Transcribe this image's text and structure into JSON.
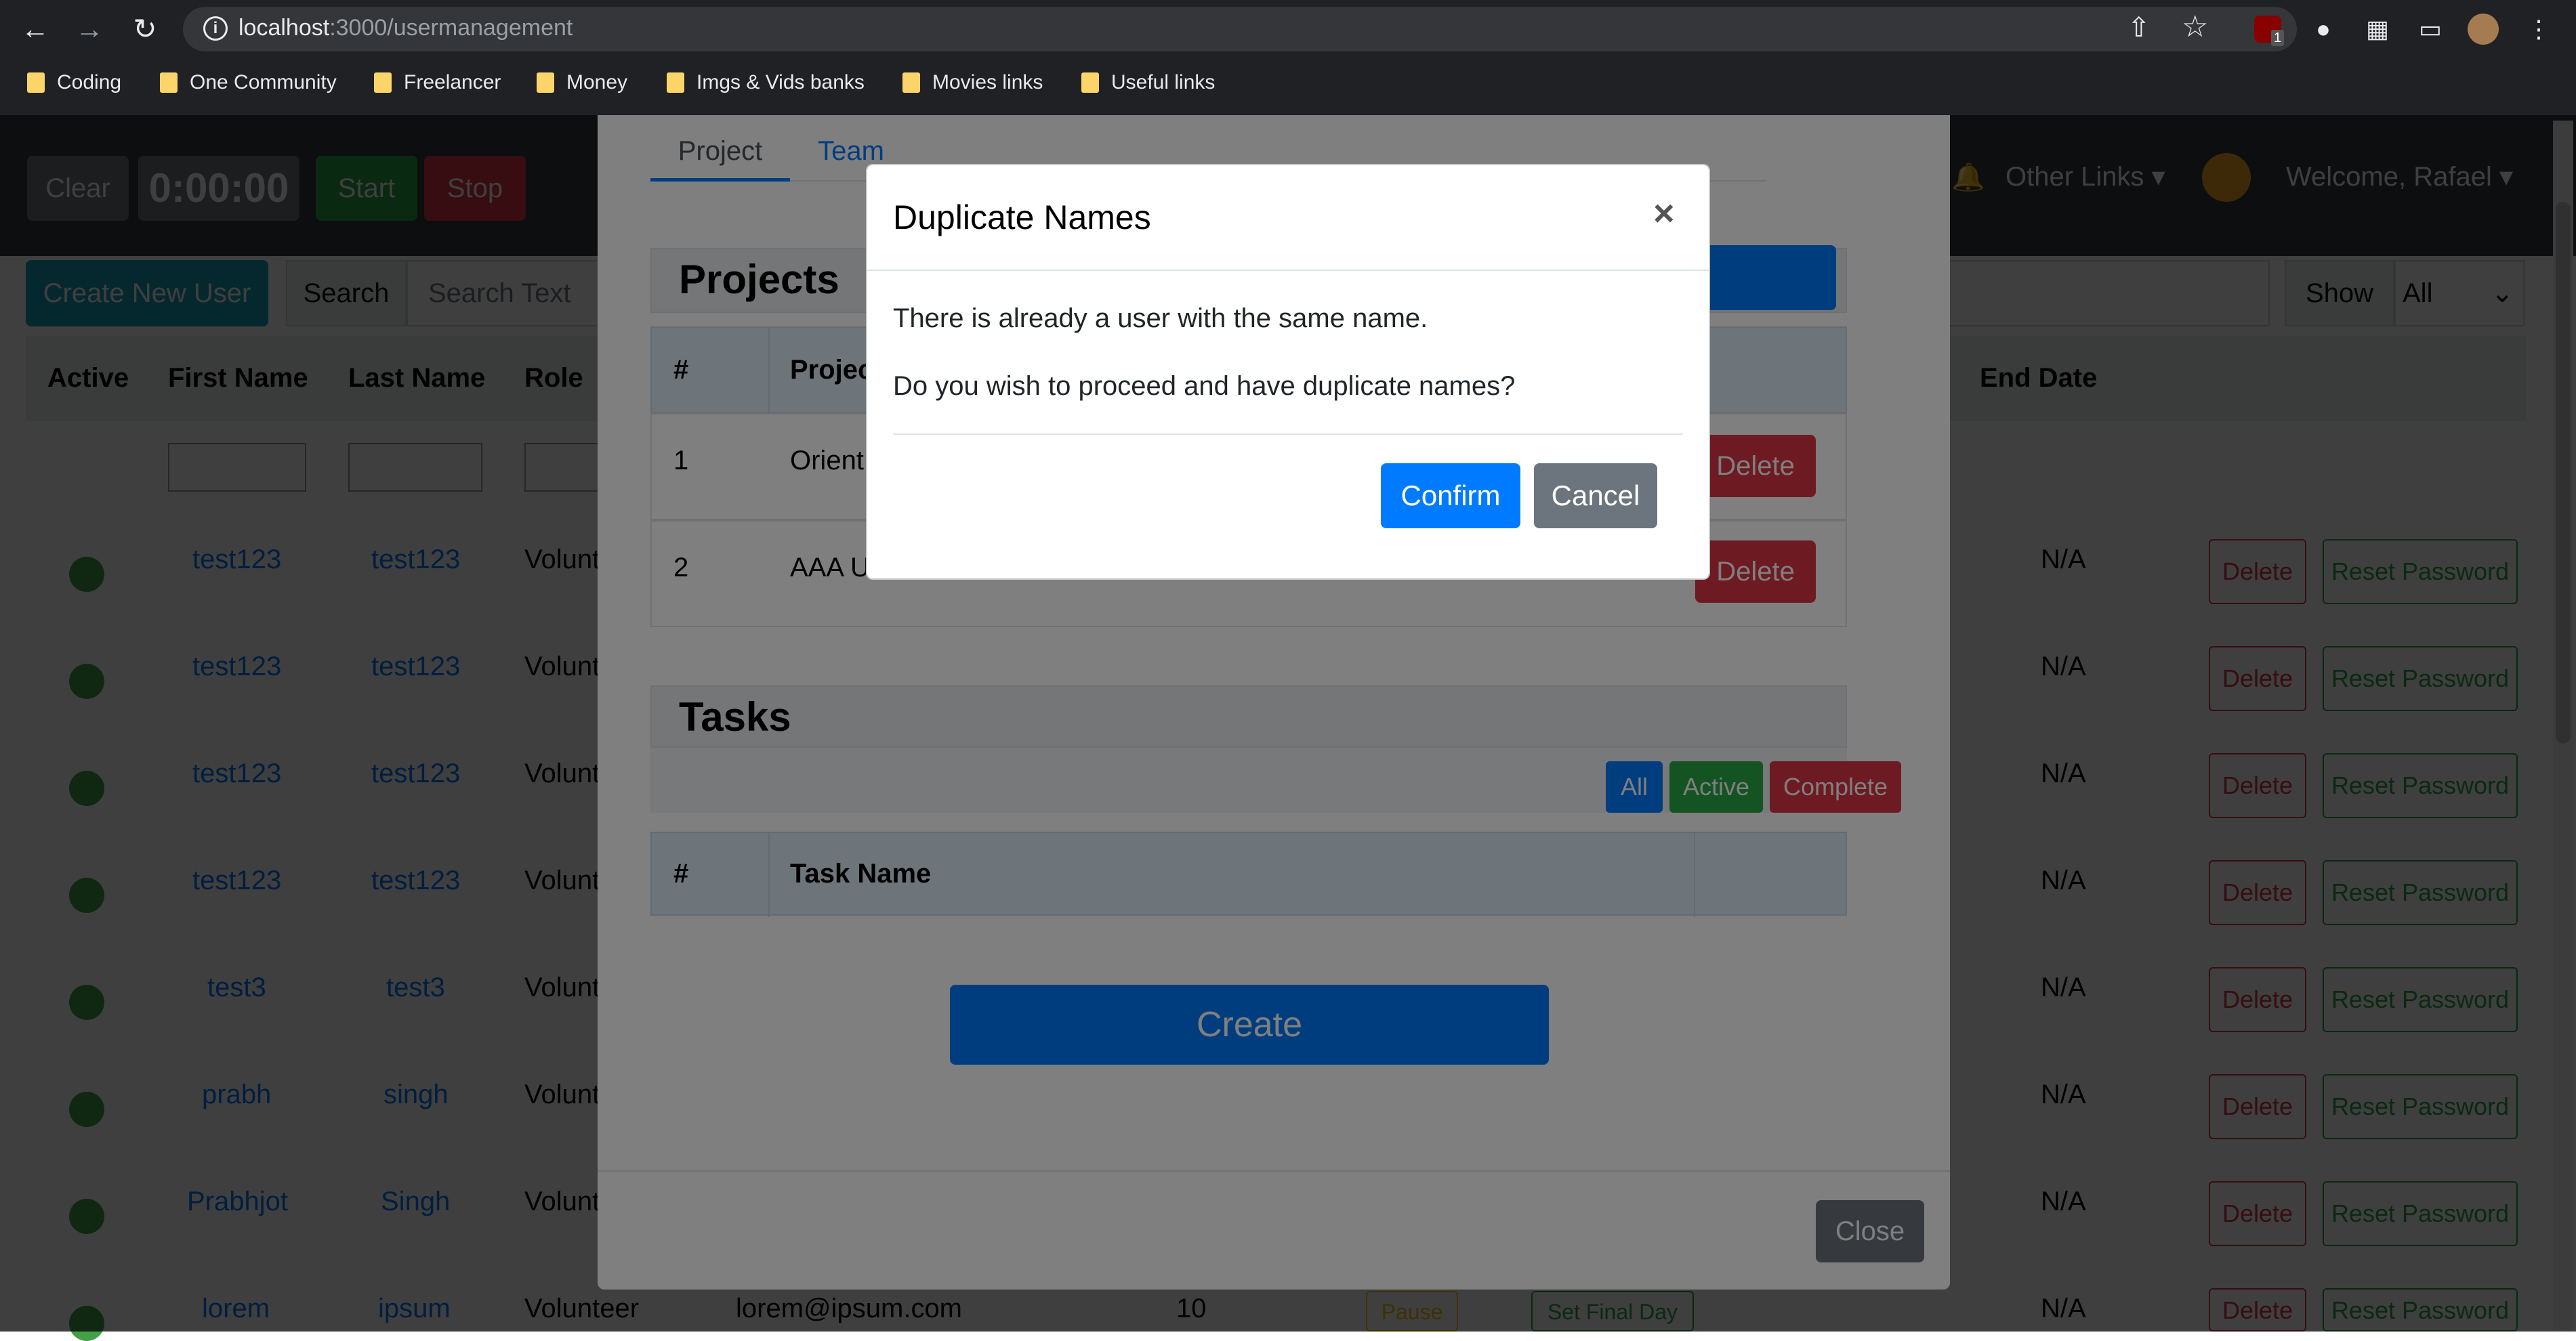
{
  "browser": {
    "url_host": "localhost",
    "url_path": ":3000/usermanagement",
    "bookmarks": [
      "Coding",
      "One Community",
      "Freelancer",
      "Money",
      "Imgs & Vids banks",
      "Movies links",
      "Useful links"
    ],
    "ext_badge": "1"
  },
  "topbar": {
    "clear": "Clear",
    "timer": "0:00:00",
    "start": "Start",
    "stop": "Stop",
    "other_links": "Other Links",
    "welcome": "Welcome, Rafael"
  },
  "toolbar": {
    "create_user": "Create New User",
    "search_label": "Search",
    "search_placeholder": "Search Text",
    "show_label": "Show",
    "show_value": "All"
  },
  "table": {
    "headers": {
      "active": "Active",
      "first": "First Name",
      "last": "Last Name",
      "role": "Role",
      "end": "End Date"
    },
    "rows": [
      {
        "first": "test123",
        "last": "test123",
        "role": "Volunt",
        "end": "N/A"
      },
      {
        "first": "test123",
        "last": "test123",
        "role": "Volunt",
        "end": "N/A"
      },
      {
        "first": "test123",
        "last": "test123",
        "role": "Volunt",
        "end": "N/A"
      },
      {
        "first": "test123",
        "last": "test123",
        "role": "Volunt",
        "end": "N/A"
      },
      {
        "first": "test3",
        "last": "test3",
        "role": "Volunt",
        "end": "N/A"
      },
      {
        "first": "prabh",
        "last": "singh",
        "role": "Volunt",
        "end": "N/A"
      },
      {
        "first": "Prabhjot",
        "last": "Singh",
        "role": "Volunt",
        "end": "N/A"
      },
      {
        "first": "lorem",
        "last": "ipsum",
        "role": "Volunteer",
        "end": "N/A",
        "email": "lorem@ipsum.com",
        "hours": "10",
        "pause": "Pause",
        "final": "Set Final Day"
      }
    ],
    "delete_label": "Delete",
    "reset_label": "Reset Password"
  },
  "modal": {
    "tabs": [
      "Project",
      "Team"
    ],
    "projects_title": "Projects",
    "proj_head_num": "#",
    "proj_head_name": "Projec",
    "projects": [
      {
        "num": "1",
        "name": "Orient"
      },
      {
        "num": "2",
        "name": "AAA U"
      }
    ],
    "delete_label": "Delete",
    "tasks_title": "Tasks",
    "filters": {
      "all": "All",
      "active": "Active",
      "complete": "Complete"
    },
    "task_head_num": "#",
    "task_head_name": "Task Name",
    "create": "Create",
    "close": "Close"
  },
  "dialog": {
    "title": "Duplicate Names",
    "close_glyph": "×",
    "line1": "There is already a user with the same name.",
    "line2": "Do you wish to proceed and have duplicate names?",
    "confirm": "Confirm",
    "cancel": "Cancel"
  },
  "colors": {
    "primary": "#007bff",
    "success": "#28a745",
    "danger": "#dc3545",
    "secondary": "#6c757d",
    "navbar": "#343a40",
    "status_active": "#43a047"
  }
}
